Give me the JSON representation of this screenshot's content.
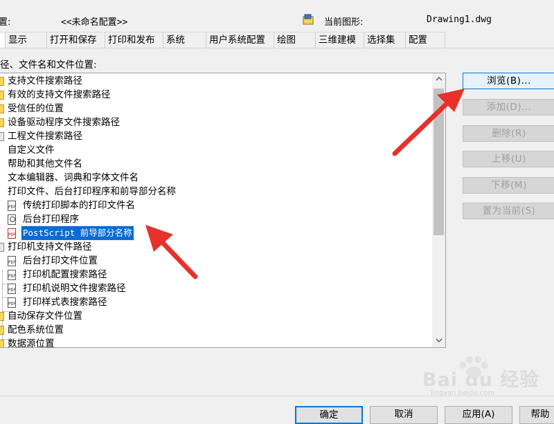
{
  "profile": {
    "label_fragment": "置:",
    "value": "<<未命名配置>>",
    "drawing_label": "当前图形:",
    "drawing_value": "Drawing1.dwg"
  },
  "tabs": [
    {
      "label": "显示"
    },
    {
      "label": "打开和保存"
    },
    {
      "label": "打印和发布"
    },
    {
      "label": "系统"
    },
    {
      "label": "用户系统配置"
    },
    {
      "label": "绘图"
    },
    {
      "label": "三维建模"
    },
    {
      "label": "选择集"
    },
    {
      "label": "配置"
    }
  ],
  "section_label": "径、文件名和文件位置:",
  "tree": [
    {
      "label": "支持文件搜索路径"
    },
    {
      "label": "有效的支持文件搜索路径"
    },
    {
      "label": "受信任的位置"
    },
    {
      "label": "设备驱动程序文件搜索路径"
    },
    {
      "label": "工程文件搜索路径"
    },
    {
      "label": "自定义文件"
    },
    {
      "label": "帮助和其他文件名"
    },
    {
      "label": "文本编辑器、词典和字体文件名"
    },
    {
      "label": "打印文件、后台打印程序和前导部分名称"
    },
    {
      "label": "传统打印脚本的打印文件名"
    },
    {
      "label": "后台打印程序"
    },
    {
      "label": "PostScript 前导部分名称"
    },
    {
      "label": "打印机支持文件路径"
    },
    {
      "label": "后台打印文件位置"
    },
    {
      "label": "打印机配置搜索路径"
    },
    {
      "label": "打印机说明文件搜索路径"
    },
    {
      "label": "打印样式表搜索路径"
    },
    {
      "label": "自动保存文件位置"
    },
    {
      "label": "配色系统位置"
    },
    {
      "label": "数据源位置"
    }
  ],
  "buttons": {
    "browse": "浏览(B)...",
    "add": "添加(D)...",
    "remove": "删除(R)",
    "move_up": "上移(U)",
    "move_down": "下移(M)",
    "set_current": "置为当前(S)"
  },
  "bottom_buttons": {
    "ok": "确定",
    "cancel": "取消",
    "apply": "应用(A)",
    "help": "帮助"
  },
  "doc_icon_text": "PDF",
  "watermark": {
    "brand": "Bai du 经验",
    "url": "jingyan.baidu.com"
  },
  "colors": {
    "selection": "#0a6bd1",
    "arrow": "#e8312a",
    "primary_border": "#0078d7"
  }
}
